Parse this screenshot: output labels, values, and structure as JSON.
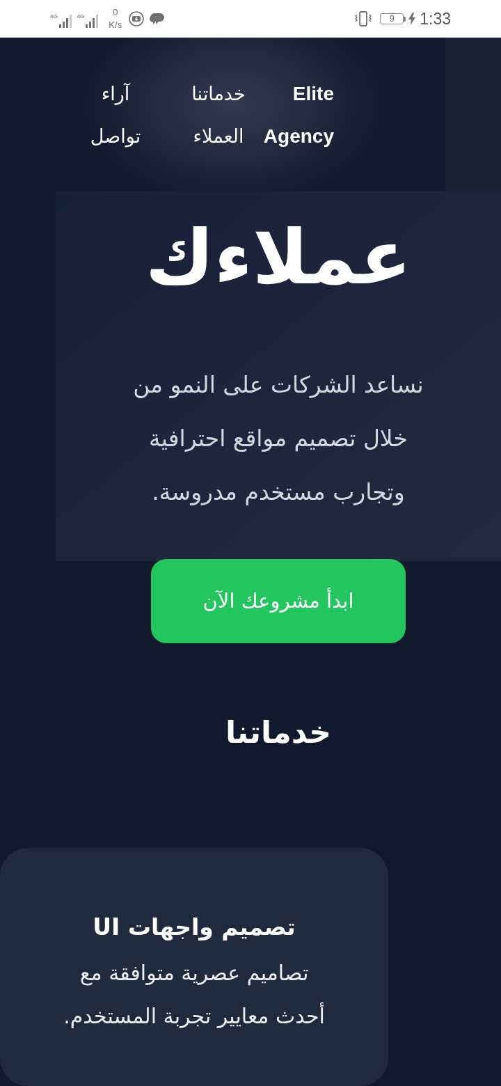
{
  "status_bar": {
    "networks": [
      {
        "label": "4G"
      },
      {
        "label": "4G"
      }
    ],
    "speed": {
      "value": "0",
      "unit": "K/s"
    },
    "battery": "9",
    "time": "1:33"
  },
  "header": {
    "logo": "Elite Agency",
    "nav": [
      {
        "label": "خدماتنا"
      },
      {
        "label": "آراء"
      },
      {
        "label": "العملاء"
      },
      {
        "label": "تواصل"
      }
    ]
  },
  "hero": {
    "title": "عملاءك",
    "text": "نساعد الشركات على النمو من خلال تصميم مواقع احترافية وتجارب مستخدم مدروسة.",
    "button": "ابدأ مشروعك الآن"
  },
  "services": {
    "title": "خدماتنا",
    "cards": [
      {
        "title": "تصميم واجهات UI",
        "text": "تصاميم عصرية متوافقة مع أحدث معايير تجربة المستخدم."
      }
    ]
  }
}
